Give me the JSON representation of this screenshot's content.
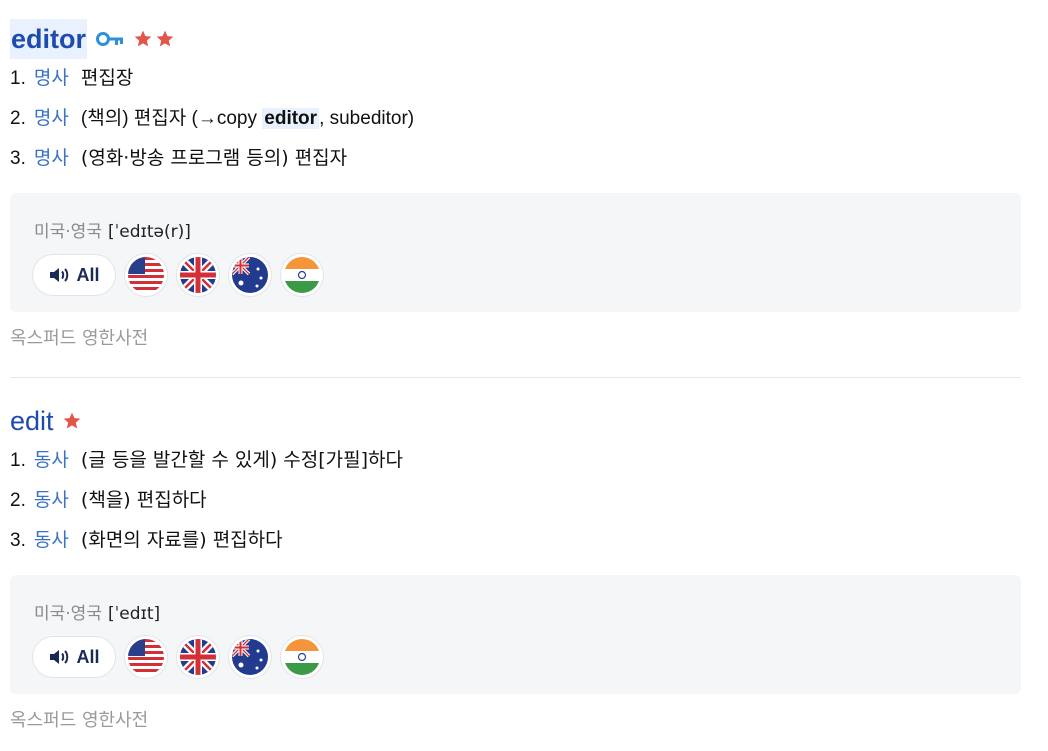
{
  "entries": [
    {
      "headword": "editor",
      "stars": 2,
      "has_key_icon": true,
      "senses": [
        {
          "num": "1.",
          "pos": "명사",
          "pre": "편집장",
          "hl": "",
          "post": ""
        },
        {
          "num": "2.",
          "pos": "명사",
          "pre": "(책의) 편집자 (→copy ",
          "hl": "editor",
          "post": ", subeditor)"
        },
        {
          "num": "3.",
          "pos": "명사",
          "pre": "(영화·방송 프로그램 등의) 편집자",
          "hl": "",
          "post": ""
        }
      ],
      "pron_label": "미국·영국",
      "pron_ipa": "[ˈedɪtə(r)]",
      "audio_all_label": "All",
      "source": "옥스퍼드 영한사전"
    },
    {
      "headword": "edit",
      "stars": 1,
      "has_key_icon": false,
      "senses": [
        {
          "num": "1.",
          "pos": "동사",
          "pre": "(글 등을 발간할 수 있게) 수정[가필]하다",
          "hl": "",
          "post": ""
        },
        {
          "num": "2.",
          "pos": "동사",
          "pre": "(책을) 편집하다",
          "hl": "",
          "post": ""
        },
        {
          "num": "3.",
          "pos": "동사",
          "pre": "(화면의 자료를) 편집하다",
          "hl": "",
          "post": ""
        }
      ],
      "pron_label": "미국·영국",
      "pron_ipa": "[ˈedɪt]",
      "audio_all_label": "All",
      "source": "옥스퍼드 영한사전"
    }
  ],
  "colors": {
    "headword": "#1f4bb0",
    "pos": "#3b73c4",
    "star": "#e0574a",
    "highlight_bg": "#e8f1fd"
  },
  "flags": [
    "us-flag-icon",
    "uk-flag-icon",
    "australia-flag-icon",
    "india-flag-icon"
  ]
}
